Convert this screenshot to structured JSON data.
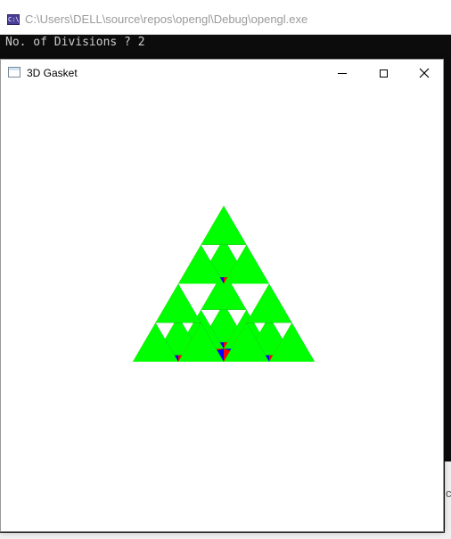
{
  "console": {
    "title": "C:\\Users\\DELL\\source\\repos\\opengl\\Debug\\opengl.exe",
    "icon_label": "C:\\",
    "output": "No. of Divisions ? 2",
    "partial_glyph": "c"
  },
  "gl_window": {
    "title": "3D Gasket",
    "icon": "application-window-icon",
    "controls": {
      "minimize": "minimize-icon",
      "maximize": "maximize-icon",
      "close": "close-icon"
    }
  },
  "gasket": {
    "divisions": 2,
    "face_colors": {
      "left": "#ff0000",
      "right": "#0000ff",
      "center": "#00ff00",
      "bottom": "#000000",
      "background": "#ffffff"
    }
  }
}
